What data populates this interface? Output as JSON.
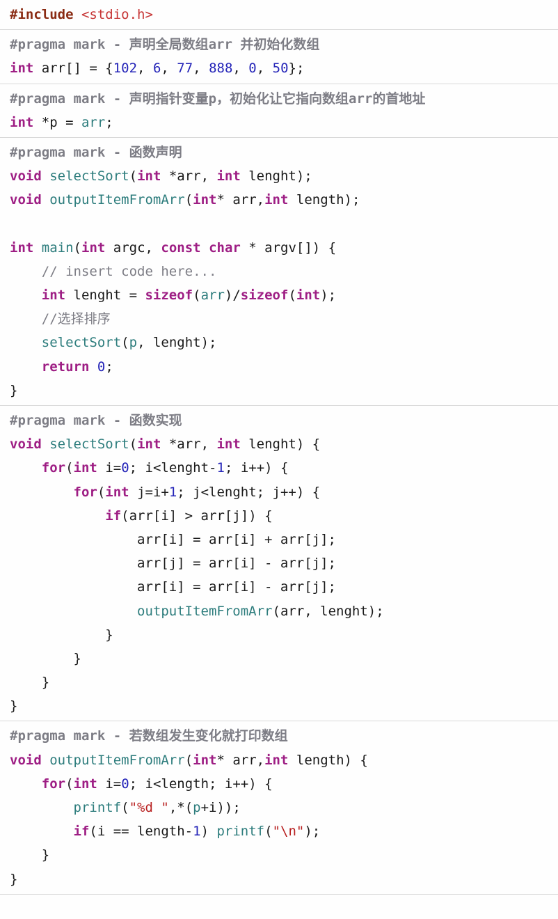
{
  "block1": {
    "t1a": "#include ",
    "t1b": "<stdio.h>"
  },
  "block2": {
    "l1a": "#pragma mark - 声明全局数组arr 并初始化数组",
    "l2a": "int",
    "l2b": " arr[] = {",
    "l2c": "102",
    "l2d": ", ",
    "l2e": "6",
    "l2f": ", ",
    "l2g": "77",
    "l2h": ", ",
    "l2i": "888",
    "l2j": ", ",
    "l2k": "0",
    "l2l": ", ",
    "l2m": "50",
    "l2n": "};"
  },
  "block3": {
    "l1a": "#pragma mark - 声明指针变量p，初始化让它指向数组arr的首地址",
    "l2a": "int",
    "l2b": " *p = ",
    "l2c": "arr",
    "l2d": ";"
  },
  "block4": {
    "l1a": "#pragma mark - 函数声明",
    "l2a": "void",
    "l2b": " ",
    "l2c": "selectSort",
    "l2d": "(",
    "l2e": "int",
    "l2f": " *arr, ",
    "l2g": "int",
    "l2h": " lenght);",
    "l3a": "void",
    "l3b": " ",
    "l3c": "outputItemFromArr",
    "l3d": "(",
    "l3e": "int",
    "l3f": "* arr,",
    "l3g": "int",
    "l3h": " length);",
    "l5a": "int",
    "l5b": " ",
    "l5c": "main",
    "l5d": "(",
    "l5e": "int",
    "l5f": " argc, ",
    "l5g": "const",
    "l5h": " ",
    "l5i": "char",
    "l5j": " * argv[]) {",
    "l6a": "    ",
    "l6b": "// insert code here...",
    "l7a": "    ",
    "l7b": "int",
    "l7c": " lenght = ",
    "l7d": "sizeof",
    "l7e": "(",
    "l7f": "arr",
    "l7g": ")/",
    "l7h": "sizeof",
    "l7i": "(",
    "l7j": "int",
    "l7k": ");",
    "l8a": "    ",
    "l8b": "//选择排序",
    "l9a": "    ",
    "l9b": "selectSort",
    "l9c": "(",
    "l9d": "p",
    "l9e": ", lenght);",
    "l10a": "    ",
    "l10b": "return",
    "l10c": " ",
    "l10d": "0",
    "l10e": ";",
    "l11a": "}"
  },
  "block5": {
    "l1a": "#pragma mark - 函数实现",
    "l2a": "void",
    "l2b": " ",
    "l2c": "selectSort",
    "l2d": "(",
    "l2e": "int",
    "l2f": " *arr, ",
    "l2g": "int",
    "l2h": " lenght) {",
    "l3a": "    ",
    "l3b": "for",
    "l3c": "(",
    "l3d": "int",
    "l3e": " i=",
    "l3f": "0",
    "l3g": "; i<lenght-",
    "l3h": "1",
    "l3i": "; i++) {",
    "l4a": "        ",
    "l4b": "for",
    "l4c": "(",
    "l4d": "int",
    "l4e": " j=i+",
    "l4f": "1",
    "l4g": "; j<lenght; j++) {",
    "l5a": "            ",
    "l5b": "if",
    "l5c": "(arr[i] > arr[j]) {",
    "l6a": "                arr[i] = arr[i] + arr[j];",
    "l7a": "                arr[j] = arr[i] - arr[j];",
    "l8a": "                arr[i] = arr[i] - arr[j];",
    "l9a": "                ",
    "l9b": "outputItemFromArr",
    "l9c": "(arr, lenght);",
    "l10a": "            }",
    "l11a": "        }",
    "l12a": "    }",
    "l13a": "}"
  },
  "block6": {
    "l1a": "#pragma mark - 若数组发生变化就打印数组",
    "l2a": "void",
    "l2b": " ",
    "l2c": "outputItemFromArr",
    "l2d": "(",
    "l2e": "int",
    "l2f": "* arr,",
    "l2g": "int",
    "l2h": " length) {",
    "l3a": "    ",
    "l3b": "for",
    "l3c": "(",
    "l3d": "int",
    "l3e": " i=",
    "l3f": "0",
    "l3g": "; i<length; i++) {",
    "l4a": "        ",
    "l4b": "printf",
    "l4c": "(",
    "l4d": "\"%d \"",
    "l4e": ",*(",
    "l4f": "p",
    "l4g": "+i));",
    "l5a": "        ",
    "l5b": "if",
    "l5c": "(i == length-",
    "l5d": "1",
    "l5e": ") ",
    "l5f": "printf",
    "l5g": "(",
    "l5h": "\"\\n\"",
    "l5i": ");",
    "l6a": "    }",
    "l7a": "}"
  }
}
